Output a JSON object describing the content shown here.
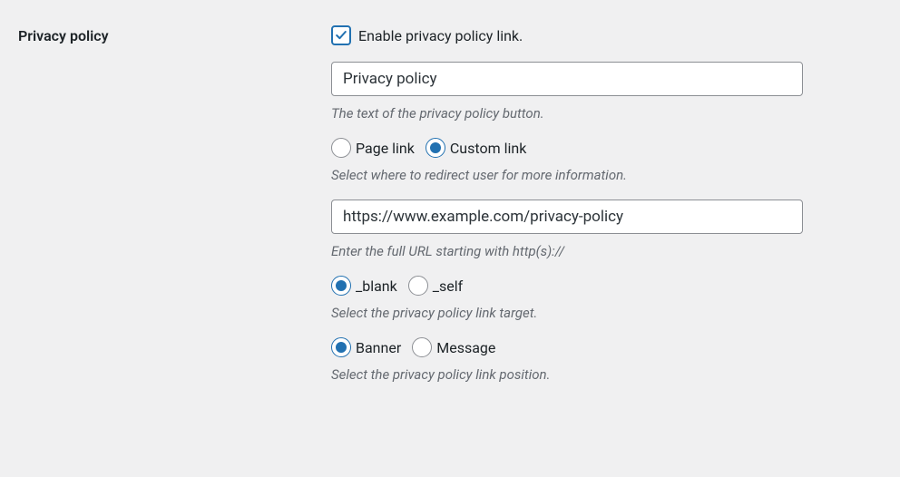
{
  "section_label": "Privacy policy",
  "enable": {
    "label": "Enable privacy policy link.",
    "checked": true
  },
  "button_text": {
    "value": "Privacy policy",
    "description": "The text of the privacy policy button."
  },
  "link_type": {
    "options": [
      {
        "label": "Page link",
        "checked": false
      },
      {
        "label": "Custom link",
        "checked": true
      }
    ],
    "description": "Select where to redirect user for more information."
  },
  "url": {
    "value": "https://www.example.com/privacy-policy",
    "description": "Enter the full URL starting with http(s)://"
  },
  "target": {
    "options": [
      {
        "label": "_blank",
        "checked": true
      },
      {
        "label": "_self",
        "checked": false
      }
    ],
    "description": "Select the privacy policy link target."
  },
  "position": {
    "options": [
      {
        "label": "Banner",
        "checked": true
      },
      {
        "label": "Message",
        "checked": false
      }
    ],
    "description": "Select the privacy policy link position."
  }
}
